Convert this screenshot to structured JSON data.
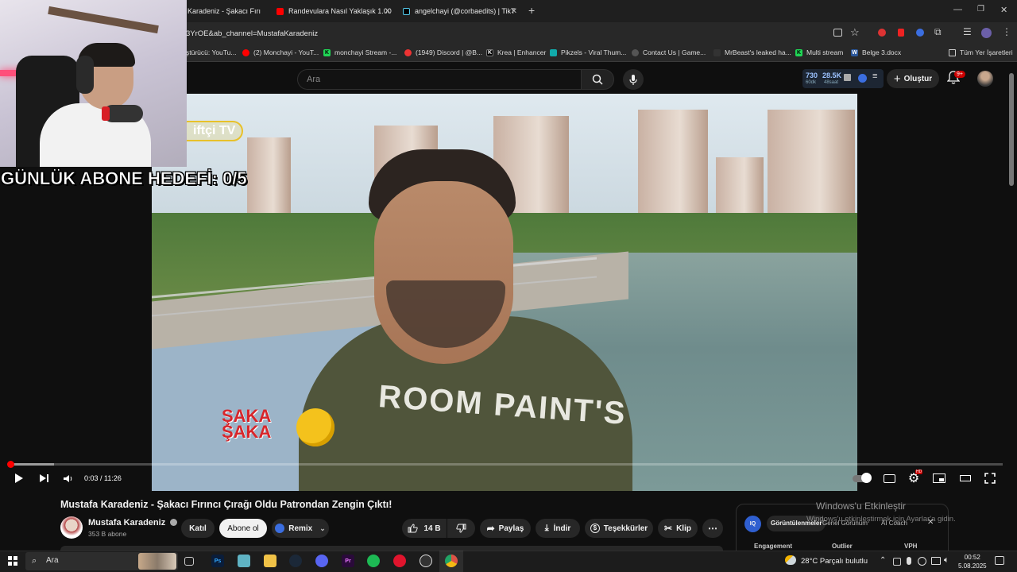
{
  "browser": {
    "tabs": [
      {
        "title": "Karadeniz - Şakacı Fırı",
        "fav": "#c00"
      },
      {
        "title": "Randevulara Nasıl Yaklaşık 1.00",
        "fav": "#ff0000"
      },
      {
        "title": "angelchayi (@corbaedits) | TikT",
        "fav": "#111"
      }
    ],
    "url": "3YrOE&ab_channel=MustafaKaradeniz",
    "bookmarks": [
      "ştürücü: YouTu...",
      "(2) Monchayi - YouT...",
      "monchayi Stream -...",
      "(1949) Discord | @B...",
      "Krea | Enhancer",
      "Pikzels - Viral Thum...",
      "Contact Us | Game...",
      "MrBeast's leaked ha...",
      "Multi stream",
      "Belge 3.docx"
    ],
    "all_bookmarks": "Tüm Yer İşaretleri"
  },
  "youtube": {
    "search_placeholder": "Ara",
    "stats": {
      "v1": "730",
      "v1sub": "60dk",
      "v2": "28.5K",
      "v2sub": "48saat"
    },
    "create_label": "Oluştur",
    "notif_count": "9+"
  },
  "overlay": {
    "goal_text": "GÜNLÜK ABONE HEDEFİ: 0/5"
  },
  "video_frame": {
    "channel_logo": "iftçi TV",
    "saka_logo_line1": "ŞAKA",
    "saka_logo_line2": "ŞAKA",
    "shirt_text": "ROOM PAINT'S"
  },
  "player": {
    "current_time": "0:03",
    "duration": "11:26",
    "time_display": "0:03 / 11:26",
    "played_fraction": 0.004,
    "buffered_fraction": 0.045,
    "settings_badge": "HD"
  },
  "video": {
    "title": "Mustafa Karadeniz - Şakacı Fırıncı Çırağı Oldu Patrondan Zengin Çıktı!",
    "channel": "Mustafa Karadeniz",
    "subscribers": "353 B abone",
    "join_label": "Katıl",
    "subscribe_label": "Abone ol",
    "remix_label": "Remix",
    "likes": "14 B",
    "share_label": "Paylaş",
    "download_label": "İndir",
    "thanks_label": "Teşekkürler",
    "clip_label": "Klip"
  },
  "iq_panel": {
    "tabs": [
      "Görüntülenmeler",
      "Genel Görünüm",
      "AI Coach"
    ],
    "columns": [
      "Engagement",
      "Outlier",
      "VPH"
    ]
  },
  "windows_activation": {
    "line1": "Windows'u Etkinleştir",
    "line2": "Windows'u etkinleştirmek için Ayarlar'a gidin."
  },
  "taskbar": {
    "search_placeholder": "Ara",
    "weather": "28°C  Parçalı bulutlu",
    "time": "00:52",
    "date": "5.08.2025"
  }
}
